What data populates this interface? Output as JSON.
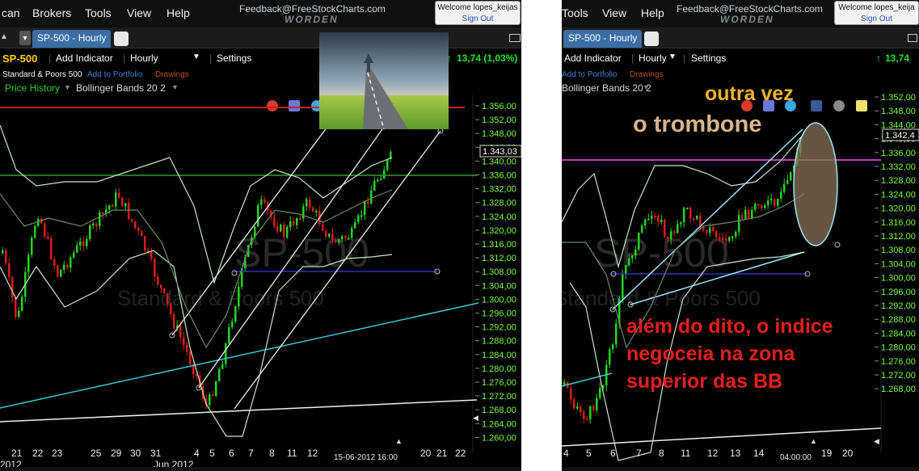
{
  "menu": {
    "items": [
      "can",
      "Brokers",
      "Tools",
      "View",
      "Help"
    ],
    "right_items": [
      "Tools",
      "View",
      "Help"
    ],
    "feedback": "Feedback@FreeStockCharts.com",
    "brand": "WORDEN",
    "welcome": "Welcome lopes_keijas",
    "welcome_right": "Welcome lopes_keija",
    "signout": "Sign Out"
  },
  "tabs": {
    "chart_tab": "SP-500 - Hourly"
  },
  "toolbar": {
    "symbol": "SP-500",
    "add_indicator": "Add Indicator",
    "interval": "Hourly",
    "settings": "Settings",
    "change": "13,74 (1,03%)",
    "change_right": "13,74"
  },
  "subbar": {
    "company": "Standard & Poors 500",
    "add_portfolio": "Add to Portfolio",
    "drawings": "Drawings"
  },
  "indicators": {
    "price_history": "Price History",
    "bollinger": "Bollinger Bands 20 2"
  },
  "watermark": {
    "symbol": "SP-500",
    "name": "Standard & Poors 500"
  },
  "left_chart": {
    "price_labels": [
      "1.356,00",
      "1.352,00",
      "1.348,00",
      "1.344,00",
      "1.340,00",
      "1.336,00",
      "1.332,00",
      "1.328,00",
      "1.324,00",
      "1.320,00",
      "1.316,00",
      "1.312,00",
      "1.308,00",
      "1.304,00",
      "1.300,00",
      "1.296,00",
      "1.292,00",
      "1.288,00",
      "1.284,00",
      "1.280,00",
      "1.276,00",
      "1.272,00",
      "1.268,00",
      "1.264,00",
      "1.260,00"
    ],
    "current_price": "1.343,03",
    "date_labels": [
      "21",
      "22",
      "23",
      "25",
      "29",
      "30",
      "31",
      "4",
      "5",
      "6",
      "7",
      "8",
      "11",
      "12",
      "20",
      "21",
      "22"
    ],
    "month_labels": [
      "2012",
      "Jun 2012"
    ],
    "cursor_date": "15-06-2012 16:00"
  },
  "right_chart": {
    "price_labels": [
      "1.352,00",
      "1.348,00",
      "1.344,00",
      "1.340,00",
      "1.336,00",
      "1.332,00",
      "1.328,00",
      "1.324,00",
      "1.320,00",
      "1.316,00",
      "1.312,00",
      "1.308,00",
      "1.304,00",
      "1.300,00",
      "1.296,00",
      "1.292,00",
      "1.288,00",
      "1.284,00",
      "1.280,00",
      "1.276,00",
      "1.272,00",
      "1.268,00"
    ],
    "current_price": "1.342,4",
    "date_labels": [
      "4",
      "5",
      "6",
      "7",
      "8",
      "11",
      "12",
      "13",
      "14",
      "19",
      "20"
    ],
    "cursor_time": "04:00:00"
  },
  "annotations": {
    "line1": "outra  vez",
    "line2": "o  trombone",
    "red1": "além do dito,  o indice",
    "red2": "negoceia na zona",
    "red3": "superior das BB"
  },
  "colors": {
    "bull": "#22d622",
    "bear": "#e01818",
    "resistance": "#c81e1e",
    "support_green": "#2ca12c",
    "magenta": "#c03cc0",
    "cyan": "#38c8d8",
    "axis_text": "#7cff3c",
    "annot_yellow": "#f0b428",
    "annot_tan": "#d8b48c",
    "annot_red": "#e81e1e"
  }
}
